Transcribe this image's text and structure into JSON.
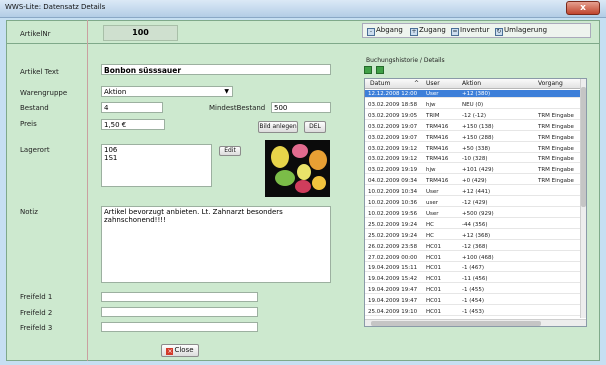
{
  "window": {
    "title": "WWS-Lite: Datensatz Details",
    "close_glyph": "x"
  },
  "labels": {
    "artikelnr": "ArtikelNr",
    "artikeltext": "Artikel Text",
    "warengruppe": "Warengruppe",
    "bestand": "Bestand",
    "mindestbestand": "MindestBestand",
    "preis": "Preis",
    "lagerort": "Lagerort",
    "notiz": "Notiz",
    "freifeld1": "Freifeld 1",
    "freifeld2": "Freifeld 2",
    "freifeld3": "Freifeld 3",
    "history": "Buchungshistorie / Details"
  },
  "values": {
    "artikelnr": "100",
    "artikeltext": "Bonbon süsssauer",
    "warengruppe": "Aktion",
    "bestand": "4",
    "mindestbestand": "500",
    "preis": "1,50 €",
    "lagerort": [
      "106",
      "1S1"
    ],
    "notiz": "Artikel bevorzugt anbieten. Lt. Zahnarzt besonders zahnschonend!!!!",
    "freifeld1": "",
    "freifeld2": "",
    "freifeld3": ""
  },
  "buttons": {
    "bild_anlegen": "Bild anlegen",
    "del": "DEL",
    "edit": "Edit",
    "close": "Close"
  },
  "toolbar": {
    "abgang": "Abgang",
    "zugang": "Zugang",
    "inventur": "Inventur",
    "umlagerung": "Umlagerung"
  },
  "grid": {
    "columns": [
      "Datum",
      "User",
      "Aktion",
      "Vorgang"
    ],
    "sort_indicator": "^",
    "rows": [
      [
        "12.12.2008 12:00",
        "User",
        "+12 (380)",
        ""
      ],
      [
        "03.02.2009 18:58",
        "hjw",
        "NEU (0)",
        ""
      ],
      [
        "03.02.2009 19:05",
        "TRIM",
        "-12 (-12)",
        "TRM Eingabe"
      ],
      [
        "03.02.2009 19:07",
        "TRM416",
        "+150 (138)",
        "TRM Eingabe"
      ],
      [
        "03.02.2009 19:07",
        "TRM416",
        "+150 (288)",
        "TRM Eingabe"
      ],
      [
        "03.02.2009 19:12",
        "TRM416",
        "+50 (338)",
        "TRM Eingabe"
      ],
      [
        "03.02.2009 19:12",
        "TRM416",
        "-10 (328)",
        "TRM Eingabe"
      ],
      [
        "03.02.2009 19:19",
        "hjw",
        "+101 (429)",
        "TRM Eingabe"
      ],
      [
        "04.02.2009 09:34",
        "TRM416",
        "+0 (429)",
        "TRM Eingabe"
      ],
      [
        "10.02.2009 10:34",
        "User",
        "+12 (441)",
        ""
      ],
      [
        "10.02.2009 10:36",
        "user",
        "-12 (429)",
        ""
      ],
      [
        "10.02.2009 19:56",
        "User",
        "+500 (929)",
        ""
      ],
      [
        "25.02.2009 19:24",
        "HC",
        "-44 (356)",
        ""
      ],
      [
        "25.02.2009 19:24",
        "HC",
        "+12 (368)",
        ""
      ],
      [
        "26.02.2009 23:58",
        "HC01",
        "-12 (368)",
        ""
      ],
      [
        "27.02.2009 00:00",
        "HC01",
        "+100 (468)",
        ""
      ],
      [
        "19.04.2009 15:11",
        "HC01",
        "-1 (467)",
        ""
      ],
      [
        "19.04.2009 15:42",
        "HC01",
        "-11 (456)",
        ""
      ],
      [
        "19.04.2009 19:47",
        "HC01",
        "-1 (455)",
        ""
      ],
      [
        "19.04.2009 19:47",
        "HC01",
        "-1 (454)",
        ""
      ],
      [
        "25.04.2009 19:10",
        "HC01",
        "-1 (453)",
        ""
      ]
    ]
  },
  "colors": {
    "client_bg": "#cde9cf",
    "selection": "#3d7fd9",
    "close_button": "#c0452e"
  }
}
